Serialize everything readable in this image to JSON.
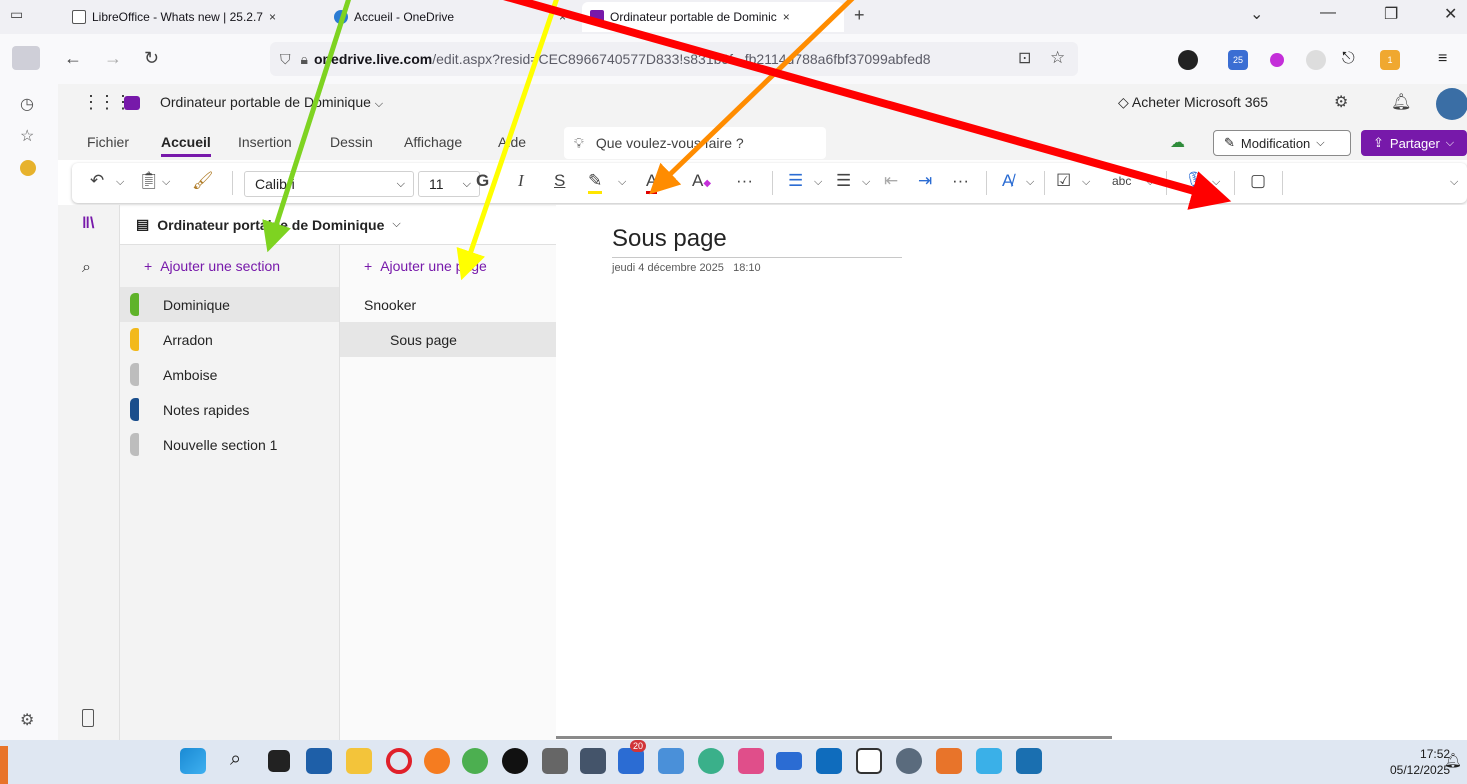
{
  "browser": {
    "tabs": [
      {
        "label": "LibreOffice - Whats new | 25.2.7",
        "close": "×"
      },
      {
        "label": "Accueil - OneDrive",
        "close": "×"
      },
      {
        "label": "Ordinateur portable de Dominic",
        "close": "×"
      }
    ],
    "new_tab": "+",
    "url_domain": "onedrive.live.com",
    "url_rest": "/edit.aspx?resid=CEC8966740577D833!s831b9f...fb2114d788a6fbf37099abfed8",
    "url_prefix": "",
    "extension_badge_1": "25",
    "extension_badge_2": "1"
  },
  "onenote": {
    "notebook_title": "Ordinateur portable de Dominique",
    "buy_label": "Acheter Microsoft 365",
    "menu_tabs": [
      "Fichier",
      "Accueil",
      "Insertion",
      "Dessin",
      "Affichage",
      "Aide"
    ],
    "selected_tab": "Accueil",
    "tellme_placeholder": "Que voulez-vous faire ?",
    "mode_label": "Modification",
    "share_label": "Partager",
    "font_name": "Calibri",
    "font_size": "11",
    "ribbon_bold": "G",
    "ribbon_italic": "I",
    "ribbon_underline": "S",
    "ribbon_more": "···",
    "notebook_header": "Ordinateur portable de Dominique",
    "add_section": "Ajouter une section",
    "add_page": "Ajouter une page",
    "sections": [
      {
        "name": "Dominique",
        "color": "#5fb32a",
        "selected": true
      },
      {
        "name": "Arradon",
        "color": "#f2b91c",
        "selected": false
      },
      {
        "name": "Amboise",
        "color": "#bdbdbd",
        "selected": false
      },
      {
        "name": "Notes rapides",
        "color": "#1a4e8c",
        "selected": false
      },
      {
        "name": "Nouvelle section 1",
        "color": "#bdbdbd",
        "selected": false
      }
    ],
    "pages": [
      {
        "name": "Snooker",
        "sub": false,
        "selected": false
      },
      {
        "name": "Sous page",
        "sub": true,
        "selected": true
      }
    ],
    "page_title": "Sous page",
    "page_date": "jeudi 4 décembre 2025",
    "page_time": "18:10"
  },
  "taskbar": {
    "time": "17:52",
    "date": "05/12/2025",
    "badge": "20"
  },
  "colors": {
    "accent": "#7719aa",
    "arrow_green": "#7ed321",
    "arrow_yellow": "#ffff00",
    "arrow_orange": "#ff8c00",
    "arrow_red": "#ff0000"
  }
}
